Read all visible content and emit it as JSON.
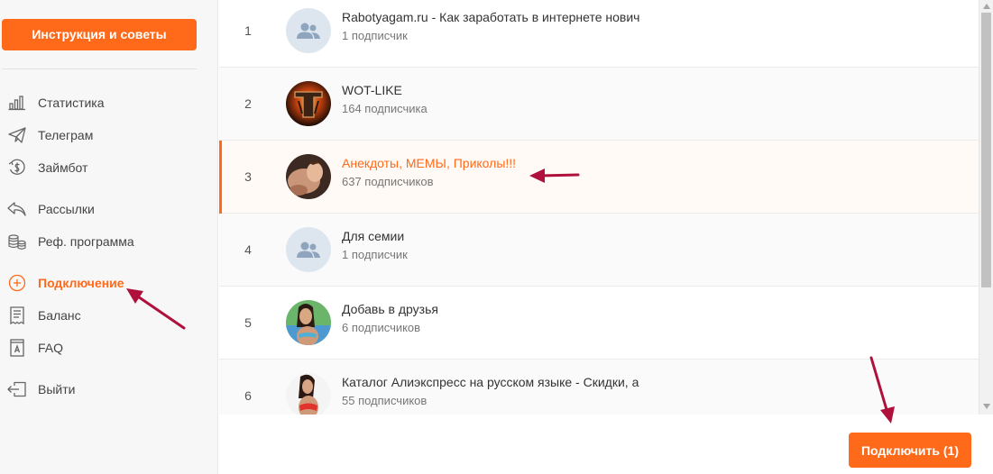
{
  "sidebar": {
    "help_button": "Инструкция и советы",
    "items": [
      {
        "label": "Статистика",
        "icon": "bar-chart-icon"
      },
      {
        "label": "Телеграм",
        "icon": "paper-plane-icon"
      },
      {
        "label": "Займбот",
        "icon": "dollar-coin-icon"
      },
      {
        "label": "Рассылки",
        "icon": "reply-arrow-icon"
      },
      {
        "label": "Реф. программа",
        "icon": "coins-stack-icon"
      },
      {
        "label": "Подключение",
        "icon": "plus-circle-icon",
        "active": true
      },
      {
        "label": "Баланс",
        "icon": "receipt-icon"
      },
      {
        "label": "FAQ",
        "icon": "faq-book-icon"
      },
      {
        "label": "Выйти",
        "icon": "logout-icon"
      }
    ]
  },
  "channels": [
    {
      "num": "1",
      "title": "Rabotyagam.ru - Как заработать в интернете нович",
      "subs": "1 подписчик",
      "avatar": "placeholder"
    },
    {
      "num": "2",
      "title": "WOT-LIKE",
      "subs": "164 подписчика",
      "avatar": "wot-logo"
    },
    {
      "num": "3",
      "title": "Анекдоты, МЕМЫ, Приколы!!!",
      "subs": "637 подписчиков",
      "avatar": "photo",
      "selected": true
    },
    {
      "num": "4",
      "title": "Для семии",
      "subs": "1 подписчик",
      "avatar": "placeholder"
    },
    {
      "num": "5",
      "title": "Добавь в друзья",
      "subs": "6 подписчиков",
      "avatar": "photo"
    },
    {
      "num": "6",
      "title": "Каталог Алиэкспресс на русском языке - Скидки, а",
      "subs": "55 подписчиков",
      "avatar": "photo"
    }
  ],
  "connect_button": "Подключить (1)",
  "colors": {
    "accent": "#ff6a1a",
    "annotation_arrow": "#b0103c"
  }
}
